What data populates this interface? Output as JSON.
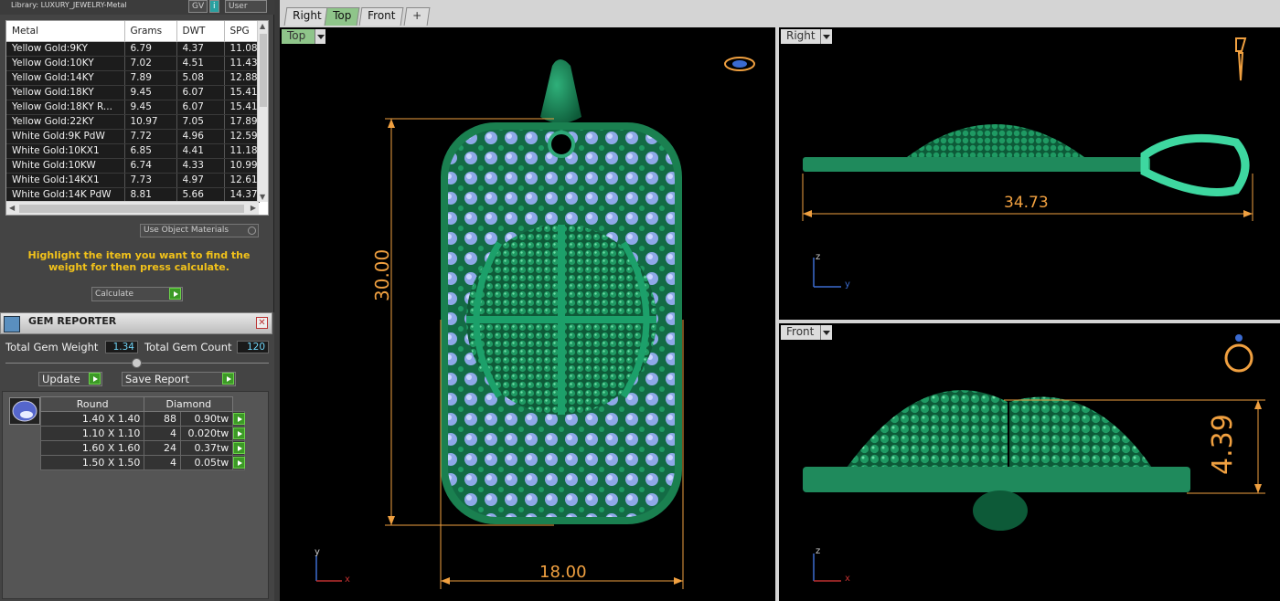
{
  "library": {
    "title": "Library: LUXURY_JEWELRY-Metal",
    "buttons": [
      "GV",
      "i",
      "User"
    ]
  },
  "metal_table": {
    "columns": [
      "Metal",
      "Grams",
      "DWT",
      "SPG"
    ],
    "rows": [
      [
        "Yellow Gold:9KY",
        "6.79",
        "4.37",
        "11.08"
      ],
      [
        "Yellow Gold:10KY",
        "7.02",
        "4.51",
        "11.43"
      ],
      [
        "Yellow Gold:14KY",
        "7.89",
        "5.08",
        "12.88"
      ],
      [
        "Yellow Gold:18KY",
        "9.45",
        "6.07",
        "15.41"
      ],
      [
        "Yellow Gold:18KY R...",
        "9.45",
        "6.07",
        "15.41"
      ],
      [
        "Yellow Gold:22KY",
        "10.97",
        "7.05",
        "17.89"
      ],
      [
        "White Gold:9K PdW",
        "7.72",
        "4.96",
        "12.59"
      ],
      [
        "White Gold:10KX1",
        "6.85",
        "4.41",
        "11.18"
      ],
      [
        "White Gold:10KW",
        "6.74",
        "4.33",
        "10.99"
      ],
      [
        "White Gold:14KX1",
        "7.73",
        "4.97",
        "12.61"
      ],
      [
        "White Gold:14K PdW",
        "8.81",
        "5.66",
        "14.37"
      ]
    ]
  },
  "use_object_materials": "Use Object Materials",
  "hint": "Highlight the item you want to find the weight for then press calculate.",
  "calculate_label": "Calculate",
  "gem_reporter": {
    "title": "GEM REPORTER",
    "total_weight_label": "Total Gem Weight",
    "total_weight_value": "1.34",
    "total_count_label": "Total Gem Count",
    "total_count_value": "120",
    "update_label": "Update",
    "save_report_label": "Save Report",
    "table_headers": [
      "Round",
      "Diamond"
    ],
    "rows": [
      [
        "1.40 X 1.40",
        "88",
        "0.90tw"
      ],
      [
        "1.10 X 1.10",
        "4",
        "0.020tw"
      ],
      [
        "1.60 X 1.60",
        "24",
        "0.37tw"
      ],
      [
        "1.50 X 1.50",
        "4",
        "0.05tw"
      ]
    ]
  },
  "tabs": [
    "Right",
    "Top",
    "Front",
    "+"
  ],
  "viewports": {
    "top": {
      "label": "Top",
      "dim_height": "30.00",
      "dim_width": "18.00",
      "axis_x": "x",
      "axis_y": "y"
    },
    "right": {
      "label": "Right",
      "dim_length": "34.73",
      "axis_z": "z",
      "axis_y": "y"
    },
    "front": {
      "label": "Front",
      "dim_depth": "4.39",
      "axis_z": "z",
      "axis_x": "x"
    }
  },
  "colors": {
    "model_green": "#1f8a5c",
    "gem_blue": "#8fa8e8",
    "dimension": "#f0a040",
    "hint_yellow": "#f2c21a",
    "value_cyan": "#6fd3f5",
    "active_tab": "#8fc58a"
  }
}
